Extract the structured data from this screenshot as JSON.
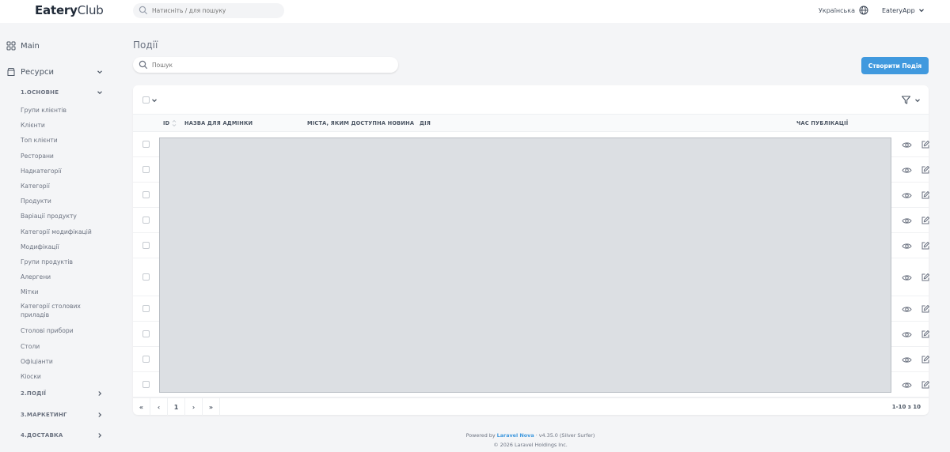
{
  "header": {
    "logo_bold": "Eatery",
    "logo_rest": "Club",
    "search_placeholder": "Натисніть / для пошуку",
    "language": "Українська",
    "app_menu": "EateryApp"
  },
  "sidebar": {
    "main_label": "Main",
    "resources_label": "Ресурси",
    "groups": [
      {
        "label": "1.ОСНОВНЕ",
        "expanded": true
      },
      {
        "label": "2.ПОДІЇ",
        "expanded": false
      },
      {
        "label": "3.МАРКЕТИНГ",
        "expanded": false
      },
      {
        "label": "4.ДОСТАВКА",
        "expanded": false
      }
    ],
    "items": [
      "Групи клієнтів",
      "Клієнти",
      "Топ клієнти",
      "Ресторани",
      "Надкатегорії",
      "Категорії",
      "Продукти",
      "Варіації продукту",
      "Категорії модифікацій",
      "Модифікації",
      "Групи продуктів",
      "Алергени",
      "Мітки",
      "Категорії столових приладів",
      "Столові прибори",
      "Столи",
      "Офіціанти",
      "Кіоски"
    ]
  },
  "main": {
    "title": "Події",
    "search_placeholder": "Пошук",
    "create_button": "Створити Подія",
    "table": {
      "columns": [
        "ID",
        "НАЗВА ДЛЯ АДМІНКИ",
        "МІСТА, ЯКИМ ДОСТУПНА НОВИНА",
        "ДІЯ",
        "ЧАС ПУБЛІКАЦІЇ"
      ],
      "row_count": 10
    },
    "pagination": {
      "first": "«",
      "prev": "‹",
      "current": "1",
      "next": "›",
      "last": "»",
      "range": "1-10 з 10"
    }
  },
  "footer": {
    "powered_prefix": "Powered by",
    "powered_link": "Laravel Nova",
    "version": "· v4.35.0 (Silver Surfer)",
    "copyright": "© 2026 Laravel Holdings Inc."
  },
  "colors": {
    "accent": "#4099de",
    "background": "#f4f5f7",
    "redacted": "#dcdfe3"
  }
}
